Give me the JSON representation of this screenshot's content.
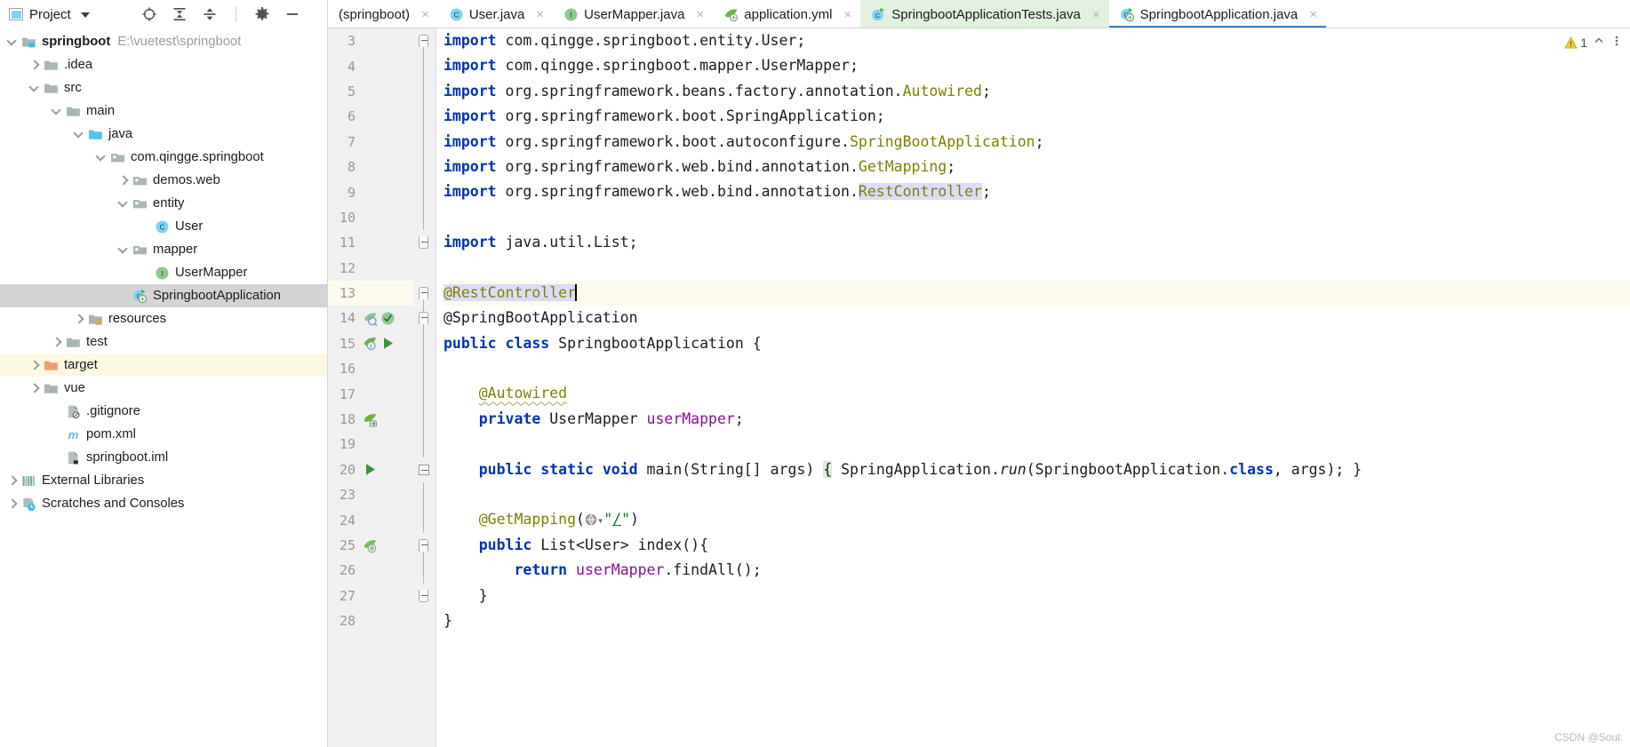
{
  "toolbar": {
    "panel_title": "Project",
    "dropdown_caret": "▾",
    "icons": [
      "locate-target-icon",
      "expand-all-icon",
      "collapse-all-icon",
      "settings-gear-icon",
      "hide-minimize-icon"
    ]
  },
  "tabs": [
    {
      "label": "(springboot)",
      "icon": "none",
      "state": "inactive",
      "close": "×"
    },
    {
      "label": "User.java",
      "icon": "java-class-icon",
      "state": "inactive",
      "close": "×"
    },
    {
      "label": "UserMapper.java",
      "icon": "java-interface-icon",
      "state": "inactive",
      "close": "×"
    },
    {
      "label": "application.yml",
      "icon": "spring-yaml-icon",
      "state": "inactive",
      "close": "×"
    },
    {
      "label": "SpringbootApplicationTests.java",
      "icon": "java-test-class-icon",
      "state": "highlighted",
      "close": "×"
    },
    {
      "label": "SpringbootApplication.java",
      "icon": "spring-boot-class-icon",
      "state": "active",
      "close": "×"
    }
  ],
  "tree": [
    {
      "label": "springboot",
      "path": "E:\\vuetest\\springboot",
      "icon": "module-folder-icon",
      "arrow": "down",
      "indent": 0,
      "bold": true,
      "state": "normal"
    },
    {
      "label": ".idea",
      "path": "",
      "icon": "folder-icon",
      "arrow": "right",
      "indent": 1,
      "bold": false,
      "state": "normal"
    },
    {
      "label": "src",
      "path": "",
      "icon": "folder-icon",
      "arrow": "down",
      "indent": 1,
      "bold": false,
      "state": "normal"
    },
    {
      "label": "main",
      "path": "",
      "icon": "folder-icon",
      "arrow": "down",
      "indent": 2,
      "bold": false,
      "state": "normal"
    },
    {
      "label": "java",
      "path": "",
      "icon": "source-root-icon",
      "arrow": "down",
      "indent": 3,
      "bold": false,
      "state": "normal"
    },
    {
      "label": "com.qingge.springboot",
      "path": "",
      "icon": "package-icon",
      "arrow": "down",
      "indent": 4,
      "bold": false,
      "state": "normal"
    },
    {
      "label": "demos.web",
      "path": "",
      "icon": "package-icon",
      "arrow": "right",
      "indent": 5,
      "bold": false,
      "state": "normal"
    },
    {
      "label": "entity",
      "path": "",
      "icon": "package-icon",
      "arrow": "down",
      "indent": 5,
      "bold": false,
      "state": "normal"
    },
    {
      "label": "User",
      "path": "",
      "icon": "java-class-icon",
      "arrow": "none",
      "indent": 6,
      "bold": false,
      "state": "normal"
    },
    {
      "label": "mapper",
      "path": "",
      "icon": "package-icon",
      "arrow": "down",
      "indent": 5,
      "bold": false,
      "state": "normal"
    },
    {
      "label": "UserMapper",
      "path": "",
      "icon": "java-interface-icon",
      "arrow": "none",
      "indent": 6,
      "bold": false,
      "state": "normal"
    },
    {
      "label": "SpringbootApplication",
      "path": "",
      "icon": "spring-boot-class-icon",
      "arrow": "none",
      "indent": 5,
      "bold": false,
      "state": "selected"
    },
    {
      "label": "resources",
      "path": "",
      "icon": "resource-root-icon",
      "arrow": "right",
      "indent": 3,
      "bold": false,
      "state": "normal"
    },
    {
      "label": "test",
      "path": "",
      "icon": "folder-icon",
      "arrow": "right",
      "indent": 2,
      "bold": false,
      "state": "normal"
    },
    {
      "label": "target",
      "path": "",
      "icon": "excluded-folder-icon",
      "arrow": "right",
      "indent": 1,
      "bold": false,
      "state": "highlighted"
    },
    {
      "label": "vue",
      "path": "",
      "icon": "folder-icon",
      "arrow": "right",
      "indent": 1,
      "bold": false,
      "state": "normal"
    },
    {
      "label": ".gitignore",
      "path": "",
      "icon": "gitignore-file-icon",
      "arrow": "none",
      "indent": 2,
      "bold": false,
      "state": "normal"
    },
    {
      "label": "pom.xml",
      "path": "",
      "icon": "maven-file-icon",
      "arrow": "none",
      "indent": 2,
      "bold": false,
      "state": "normal"
    },
    {
      "label": "springboot.iml",
      "path": "",
      "icon": "iml-file-icon",
      "arrow": "none",
      "indent": 2,
      "bold": false,
      "state": "normal"
    },
    {
      "label": "External Libraries",
      "path": "",
      "icon": "libraries-icon",
      "arrow": "right",
      "indent": 0,
      "bold": false,
      "state": "normal"
    },
    {
      "label": "Scratches and Consoles",
      "path": "",
      "icon": "scratches-icon",
      "arrow": "right",
      "indent": 0,
      "bold": false,
      "state": "normal"
    }
  ],
  "editor": {
    "file": "SpringbootApplication.java",
    "warning_count": "1",
    "lines": [
      {
        "num": "3",
        "gutter": [],
        "fold": "fold-top",
        "caretline": false
      },
      {
        "num": "4",
        "gutter": [],
        "fold": "fold-body",
        "caretline": false
      },
      {
        "num": "5",
        "gutter": [],
        "fold": "fold-body",
        "caretline": false
      },
      {
        "num": "6",
        "gutter": [],
        "fold": "fold-body",
        "caretline": false
      },
      {
        "num": "7",
        "gutter": [],
        "fold": "fold-body",
        "caretline": false
      },
      {
        "num": "8",
        "gutter": [],
        "fold": "fold-body",
        "caretline": false
      },
      {
        "num": "9",
        "gutter": [],
        "fold": "fold-body",
        "caretline": false
      },
      {
        "num": "10",
        "gutter": [],
        "fold": "fold-body",
        "caretline": false
      },
      {
        "num": "11",
        "gutter": [],
        "fold": "fold-bottom",
        "caretline": false
      },
      {
        "num": "12",
        "gutter": [],
        "fold": "none",
        "caretline": false
      },
      {
        "num": "13",
        "gutter": [],
        "fold": "fold-top",
        "caretline": true
      },
      {
        "num": "14",
        "gutter": [
          "spring-bean-icon",
          "test-ok-icon"
        ],
        "fold": "fold-top2",
        "caretline": false
      },
      {
        "num": "15",
        "gutter": [
          "spring-boot-bean-icon",
          "run-icon"
        ],
        "fold": "fold-line",
        "caretline": false
      },
      {
        "num": "16",
        "gutter": [],
        "fold": "fold-line",
        "caretline": false
      },
      {
        "num": "17",
        "gutter": [],
        "fold": "fold-line",
        "caretline": false
      },
      {
        "num": "18",
        "gutter": [
          "spring-inject-icon"
        ],
        "fold": "fold-line",
        "caretline": false
      },
      {
        "num": "19",
        "gutter": [],
        "fold": "fold-line",
        "caretline": false
      },
      {
        "num": "20",
        "gutter": [
          "run-icon"
        ],
        "fold": "fold-collapsed",
        "caretline": false
      },
      {
        "num": "23",
        "gutter": [],
        "fold": "fold-line",
        "caretline": false
      },
      {
        "num": "24",
        "gutter": [],
        "fold": "fold-line",
        "caretline": false
      },
      {
        "num": "25",
        "gutter": [
          "spring-mapping-icon"
        ],
        "fold": "fold-top",
        "caretline": false
      },
      {
        "num": "26",
        "gutter": [],
        "fold": "fold-body",
        "caretline": false
      },
      {
        "num": "27",
        "gutter": [],
        "fold": "fold-bottom",
        "caretline": false
      },
      {
        "num": "28",
        "gutter": [],
        "fold": "none",
        "caretline": false
      }
    ],
    "code_text": [
      "import com.qingge.springboot.entity.User;",
      "import com.qingge.springboot.mapper.UserMapper;",
      "import org.springframework.beans.factory.annotation.Autowired;",
      "import org.springframework.boot.SpringApplication;",
      "import org.springframework.boot.autoconfigure.SpringBootApplication;",
      "import org.springframework.web.bind.annotation.GetMapping;",
      "import org.springframework.web.bind.annotation.RestController;",
      "",
      "import java.util.List;",
      "",
      "@RestController",
      "@SpringBootApplication",
      "public class SpringbootApplication {",
      "",
      "    @Autowired",
      "    private UserMapper userMapper;",
      "",
      "    public static void main(String[] args) { SpringApplication.run(SpringbootApplication.class, args); }",
      "",
      "    @GetMapping(\"/\")",
      "    public List<User> index(){",
      "        return userMapper.findAll();",
      "    }",
      "}"
    ]
  },
  "watermark": "CSDN @Soul:"
}
